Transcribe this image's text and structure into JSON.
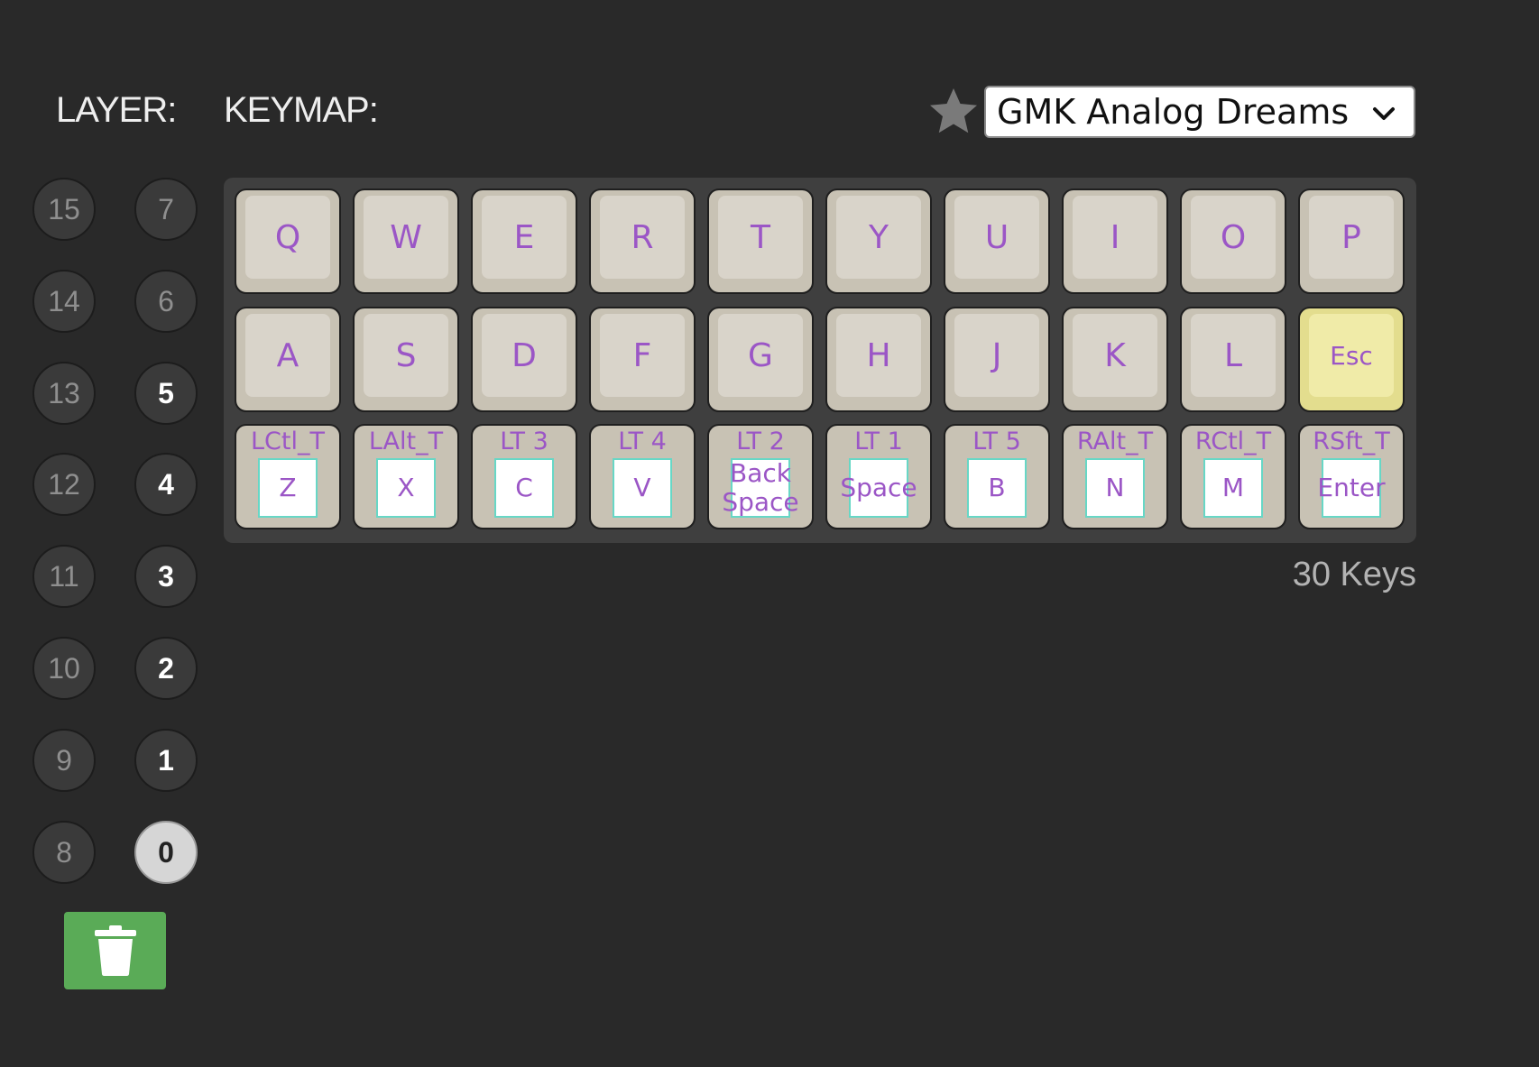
{
  "header": {
    "layer_label": "LAYER:",
    "keymap_label": "KEYMAP:",
    "favorite_icon": "star-icon",
    "keymap_select": {
      "value": "GMK Analog Dreams"
    }
  },
  "layers": {
    "left_column": [
      "15",
      "14",
      "13",
      "12",
      "11",
      "10",
      "9",
      "8"
    ],
    "right_column": [
      "7",
      "6",
      "5",
      "4",
      "3",
      "2",
      "1",
      "0"
    ],
    "active": "0",
    "used": [
      "5",
      "4",
      "3",
      "2",
      "1"
    ]
  },
  "trash_button": {
    "icon": "trash-icon"
  },
  "keyboard": {
    "row1": [
      "Q",
      "W",
      "E",
      "R",
      "T",
      "Y",
      "U",
      "I",
      "O",
      "P"
    ],
    "row2": [
      "A",
      "S",
      "D",
      "F",
      "G",
      "H",
      "J",
      "K",
      "L",
      "Esc"
    ],
    "row3": [
      {
        "top": "LCtl_T",
        "inner": "Z"
      },
      {
        "top": "LAlt_T",
        "inner": "X"
      },
      {
        "top": "LT 3",
        "inner": "C"
      },
      {
        "top": "LT 4",
        "inner": "V"
      },
      {
        "top": "LT 2",
        "inner": "Back\nSpace"
      },
      {
        "top": "LT 1",
        "inner": "Space"
      },
      {
        "top": "LT 5",
        "inner": "B"
      },
      {
        "top": "RAlt_T",
        "inner": "N"
      },
      {
        "top": "RCtl_T",
        "inner": "M"
      },
      {
        "top": "RSft_T",
        "inner": "Enter"
      }
    ],
    "key_count": "30 Keys"
  },
  "colors": {
    "background": "#292929",
    "keycap_base": "#d9d4ca",
    "legend": "#9b56c6",
    "esc_key": "#f0eba8",
    "inner_border": "#67d7c6",
    "trash": "#5aab57"
  }
}
